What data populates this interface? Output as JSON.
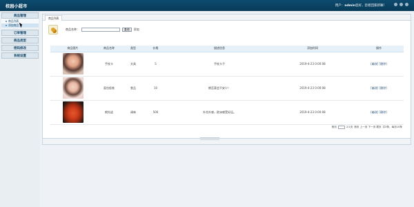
{
  "header": {
    "brand": "校园小超市",
    "welcome_prefix": "用户：",
    "user": "admin",
    "welcome_suffix": "您好，您者回家新嘛！"
  },
  "sidebar": {
    "menus": [
      {
        "label": "商品管理",
        "items": [
          {
            "label": "商品列表",
            "active": false
          },
          {
            "label": "添加商品",
            "active": true
          }
        ]
      },
      {
        "label": "订单管理"
      },
      {
        "label": "商品类型"
      },
      {
        "label": "密码修改"
      },
      {
        "label": "系统设置"
      }
    ]
  },
  "tab": {
    "label": "商品列表"
  },
  "search": {
    "label": "商品名称：",
    "value": "",
    "button": "查询",
    "add": "添加"
  },
  "table": {
    "headers": [
      "商品图片",
      "商品名称",
      "类型",
      "价格",
      "描述信息",
      "添加时间",
      "操作"
    ],
    "rows": [
      {
        "name": "手杖卡",
        "type": "文具",
        "price": "5",
        "desc": "手杖卡子",
        "time": "2019-4-23 0:00:08",
        "edit": "[编改]",
        "del": "[删除]"
      },
      {
        "name": "面包饭卷",
        "type": "食品",
        "price": "10",
        "desc": "朗怎莫会不安少！",
        "time": "2019-4-23 0:00:08",
        "edit": "[编改]",
        "del": "[删除]"
      },
      {
        "name": "朗先逃",
        "type": "调味",
        "price": "500",
        "desc": "外合外感，欧洲感受好运。",
        "time": "2019-4-23 0:00:08",
        "edit": "[编改]",
        "del": "[删除]"
      }
    ]
  },
  "pager": {
    "text1": "首页",
    "text2": "2/1页",
    "text3": "首页 上一页 下一页 尾页",
    "text4": "共3条，每页10条"
  }
}
